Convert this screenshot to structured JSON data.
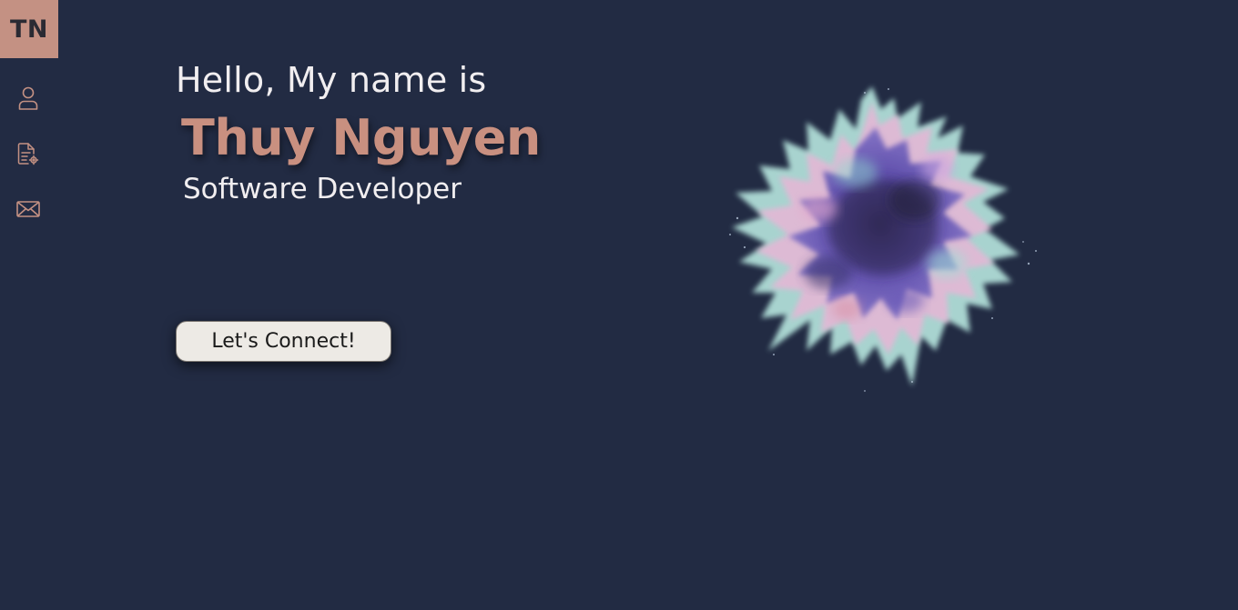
{
  "sidebar": {
    "logo_text": "TN",
    "items": [
      {
        "icon": "user-icon",
        "label": "About"
      },
      {
        "icon": "resume-icon",
        "label": "Resume"
      },
      {
        "icon": "mail-icon",
        "label": "Contact"
      }
    ]
  },
  "hero": {
    "greeting": "Hello, My name is",
    "name": "Thuy Nguyen",
    "role": "Software Developer",
    "cta_label": "Let's Connect!"
  },
  "colors": {
    "background": "#222b43",
    "accent": "#c49183",
    "text": "#f1eef0",
    "button_bg": "#edeae5"
  }
}
